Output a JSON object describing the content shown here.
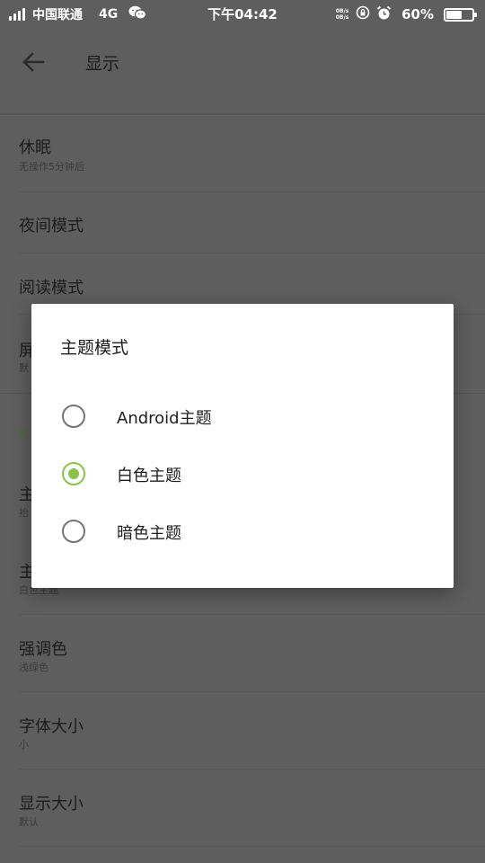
{
  "status_bar": {
    "carrier": "中国联通",
    "network": "4G",
    "time": "下午04:42",
    "speed_up": "0B/s",
    "speed_down": "0B/s",
    "battery": "60%",
    "battery_level": 0.6
  },
  "toolbar": {
    "title": "显示"
  },
  "settings": {
    "sleep": {
      "title": "休眠",
      "subtitle": "无操作5分钟后"
    },
    "night_mode": {
      "title": "夜间模式"
    },
    "reading_mode": {
      "title": "阅读模式"
    },
    "hidden_row_1": {
      "title": "屏",
      "subtitle": "默"
    },
    "section_label": "系",
    "hidden_row_2": {
      "title": "主",
      "subtitle": "抬"
    },
    "hidden_row_3": {
      "title": "主",
      "subtitle": "白色主题"
    },
    "accent_color": {
      "title": "强调色",
      "subtitle": "浅绿色"
    },
    "font_size": {
      "title": "字体大小",
      "subtitle": "小"
    },
    "display_size": {
      "title": "显示大小",
      "subtitle": "默认"
    }
  },
  "dialog": {
    "title": "主题模式",
    "options": [
      {
        "label": "Android主题",
        "checked": false
      },
      {
        "label": "白色主题",
        "checked": true
      },
      {
        "label": "暗色主题",
        "checked": false
      }
    ],
    "accent": "#8bc34a"
  }
}
